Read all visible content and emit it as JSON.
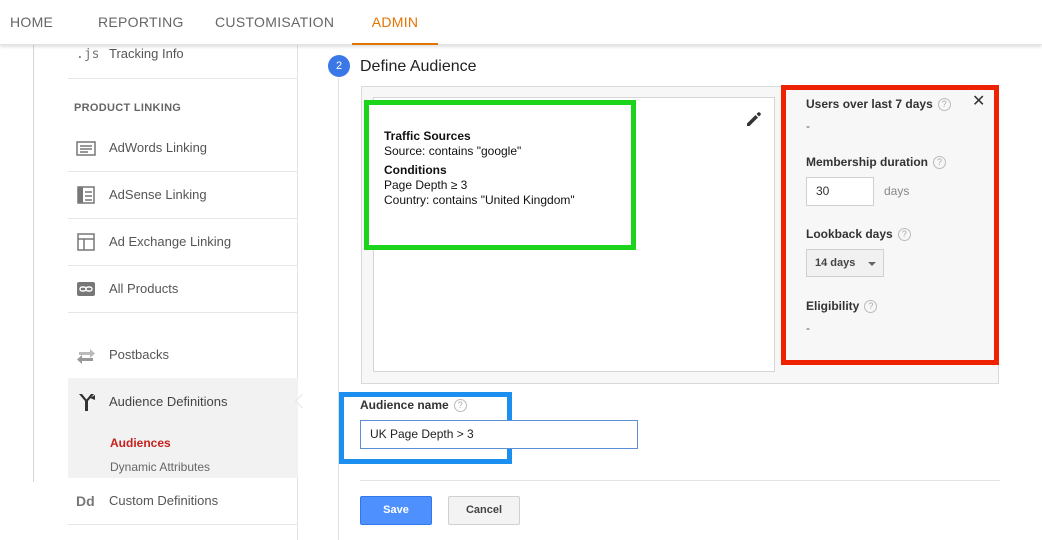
{
  "topnav": {
    "tabs": [
      {
        "label": "HOME"
      },
      {
        "label": "REPORTING"
      },
      {
        "label": "CUSTOMISATION"
      },
      {
        "label": "ADMIN",
        "active": true
      }
    ]
  },
  "sidebar": {
    "tracking_info": {
      "label": "Tracking Info",
      "icon": "js-icon"
    },
    "section_label": "PRODUCT LINKING",
    "items": [
      {
        "label": "AdWords Linking",
        "icon": "adwords-icon"
      },
      {
        "label": "AdSense Linking",
        "icon": "adsense-icon"
      },
      {
        "label": "Ad Exchange Linking",
        "icon": "ad-exchange-icon"
      },
      {
        "label": "All Products",
        "icon": "link-icon"
      },
      {
        "label": "Postbacks",
        "icon": "postbacks-icon"
      },
      {
        "label": "Custom Definitions",
        "icon": "dd-icon"
      }
    ],
    "audience_definitions": {
      "label": "Audience Definitions",
      "icon": "audience-fork-icon",
      "sub_active": "Audiences",
      "sub_other": "Dynamic Attributes"
    }
  },
  "step": {
    "number": "2",
    "title": "Define Audience"
  },
  "conditions": {
    "traffic_title": "Traffic Sources",
    "traffic_line": "Source: contains \"google\"",
    "conditions_title": "Conditions",
    "cond_line1": "Page Depth ≥ 3",
    "cond_line2": "Country: contains \"United Kingdom\""
  },
  "side_panel": {
    "users_label": "Users over last 7 days",
    "users_value": "-",
    "membership_label": "Membership duration",
    "membership_value": "30",
    "membership_unit": "days",
    "lookback_label": "Lookback days",
    "lookback_value": "14 days",
    "eligibility_label": "Eligibility",
    "eligibility_value": "-",
    "close": "✕",
    "help": "?"
  },
  "audience_name": {
    "label": "Audience name",
    "value": "UK Page Depth > 3"
  },
  "buttons": {
    "save": "Save",
    "cancel": "Cancel"
  },
  "colors": {
    "accent_admin": "#e37400",
    "save_blue": "#4d90fe",
    "highlight_green": "#1bd41b",
    "highlight_red": "#ee2200",
    "highlight_blue": "#1a8ff0",
    "active_sub": "#c5221f"
  }
}
